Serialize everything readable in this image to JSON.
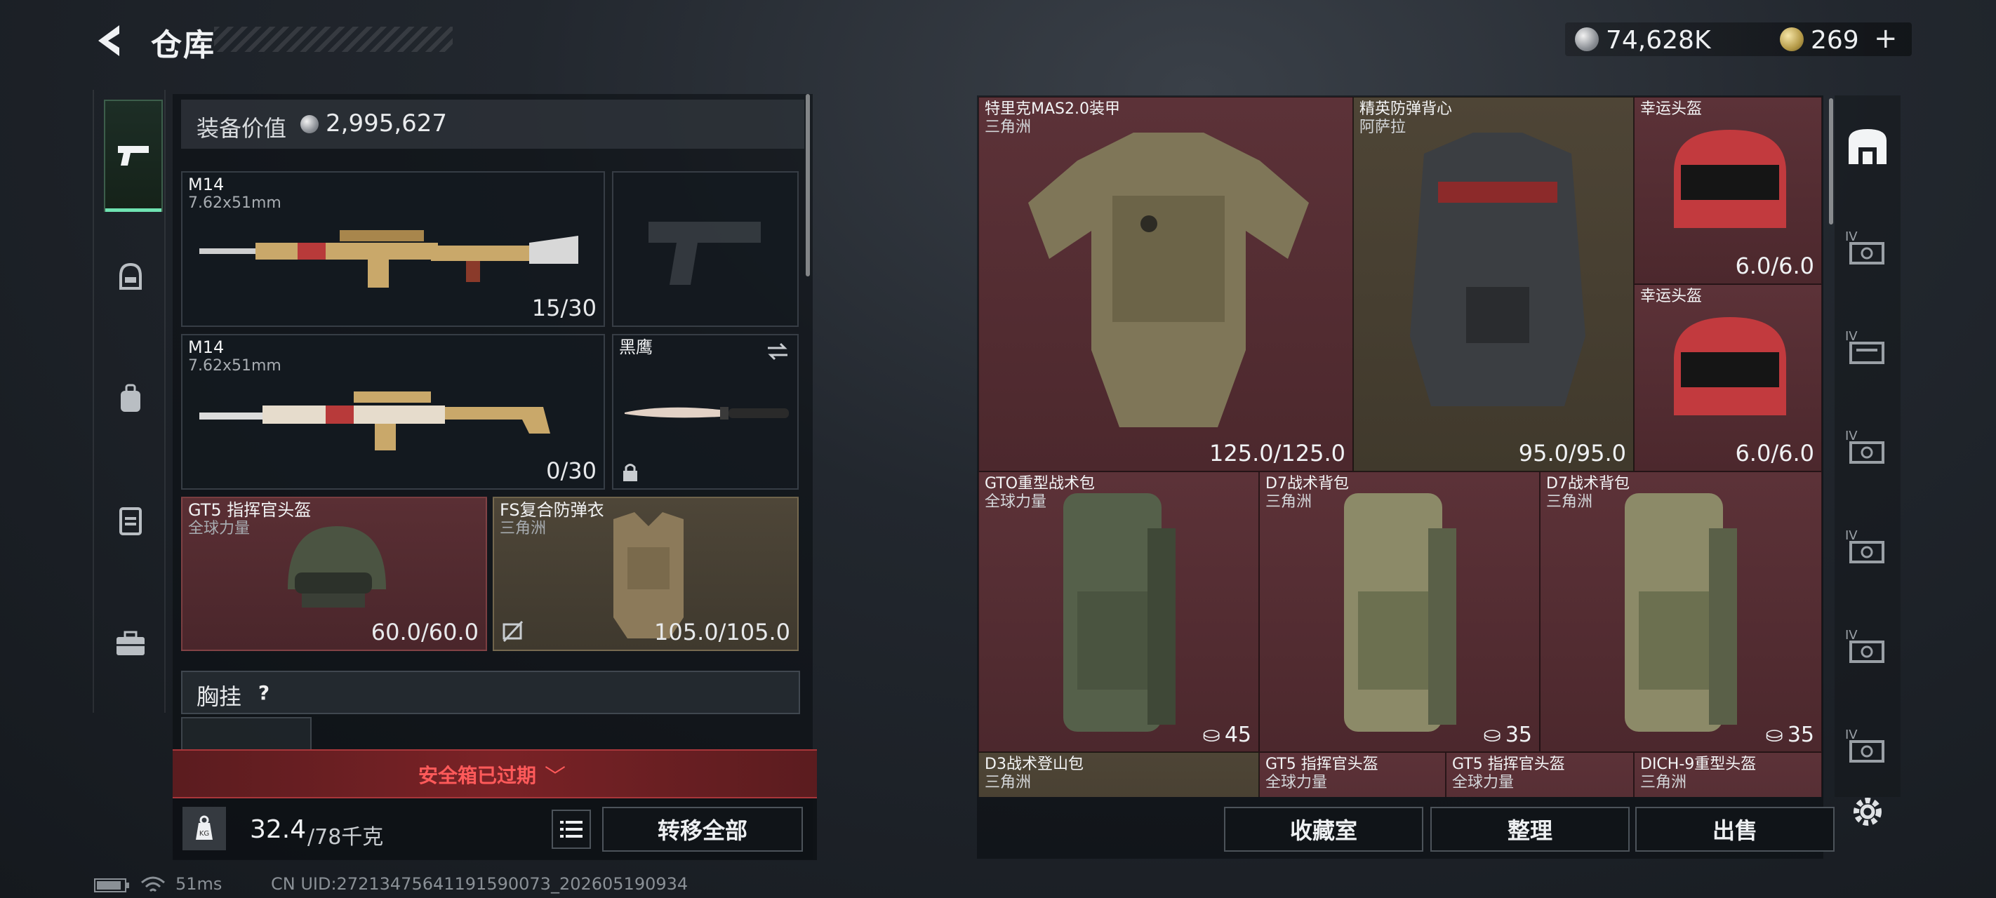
{
  "header": {
    "title": "仓库",
    "currency_silver": "74,628K",
    "currency_gold": "269"
  },
  "left": {
    "equip_label": "装备价值",
    "equip_value": "2,995,627",
    "primary_1": {
      "name": "M14",
      "caliber": "7.62x51mm",
      "ammo": "15/30"
    },
    "primary_2": {
      "name": "M14",
      "caliber": "7.62x51mm",
      "ammo": "0/30"
    },
    "melee": {
      "name": "黑鹰"
    },
    "helmet": {
      "name": "GT5 指挥官头盔",
      "source": "全球力量",
      "durability": "60.0/60.0"
    },
    "armor": {
      "name": "FS复合防弹衣",
      "source": "三角洲",
      "durability": "105.0/105.0"
    },
    "chest_label": "胸挂",
    "chest_help": "?",
    "safe_box_text": "安全箱已过期",
    "weight_current": "32.4",
    "weight_max": "/78千克",
    "transfer_all": "转移全部",
    "weight_icon_text": "KG"
  },
  "stash": {
    "items": [
      {
        "name": "特里克MAS2.0装甲",
        "source": "三角洲",
        "value": "125.0/125.0"
      },
      {
        "name": "精英防弹背心",
        "source": "阿萨拉",
        "value": "95.0/95.0"
      },
      {
        "name": "幸运头盔",
        "source": "",
        "value": "6.0/6.0"
      },
      {
        "name": "幸运头盔",
        "source": "",
        "value": "6.0/6.0"
      },
      {
        "name": "GTO重型战术包",
        "source": "全球力量",
        "value": "45"
      },
      {
        "name": "D7战术背包",
        "source": "三角洲",
        "value": "35"
      },
      {
        "name": "D7战术背包",
        "source": "三角洲",
        "value": "35"
      },
      {
        "name": "D3战术登山包",
        "source": "三角洲",
        "value": ""
      },
      {
        "name": "GT5 指挥官头盔",
        "source": "全球力量",
        "value": ""
      },
      {
        "name": "GT5 指挥官头盔",
        "source": "全球力量",
        "value": ""
      },
      {
        "name": "DICH-9重型头盔",
        "source": "三角洲",
        "value": ""
      }
    ]
  },
  "right_tabs": [
    "IV",
    "IV",
    "IV",
    "IV",
    "IV",
    "IV",
    "IV"
  ],
  "bottom": {
    "collection": "收藏室",
    "organize": "整理",
    "sell": "出售"
  },
  "status": {
    "ping": "51ms",
    "uid": "CN UID:27213475641191590073_202605190934"
  },
  "colors": {
    "accent_green": "#6fe3b2",
    "warning_red": "#ff5a5a",
    "rarity_red": "#5c3238",
    "rarity_tan": "#4e4536"
  }
}
